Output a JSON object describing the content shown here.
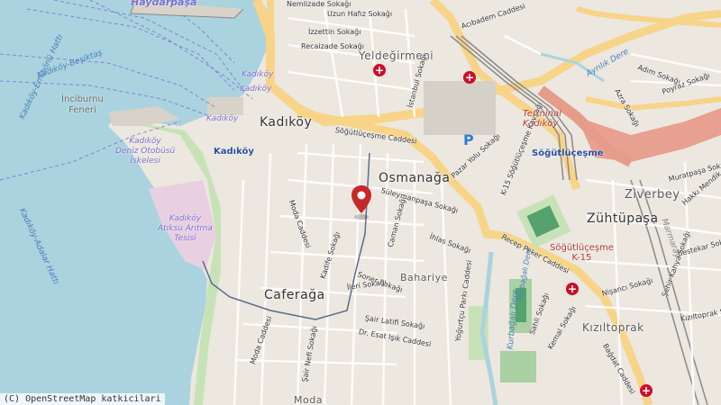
{
  "map": {
    "marker": "map-pin-icon",
    "attribution": "(C) OpenStreetMap katkicilari",
    "districts": {
      "kadikoy": "Kadıköy",
      "osmanaga": "Osmanağa",
      "caferaga": "Caferağa",
      "zuhtupasa": "Zühtüpaşa",
      "ziverbey": "Ziverbey",
      "yeldegirmeni": "Yeldeğirmeni",
      "kiziltoprak": "Kızıltoprak",
      "bahariye": "Bahariye",
      "haydarpasa": "Haydarpaşa",
      "moda": "Moda"
    },
    "pois": {
      "incirburnu": "İnciburnu\nFeneri",
      "otobus": "Kadıköy\nDeniz Otobüsü\nİskelesi",
      "aritma": "Kadıköy\nAtıksu Arıtma\nTesisi",
      "kadikoy_stop": "Kadıköy",
      "terminal": "Terminal\nKadıköy",
      "sogutlucesme_station": "Söğütlüçeşme",
      "k15a": "Söğütlüçeşme\nK-15",
      "kadikoy_ferry1": "Kadıköy",
      "kadikoy_ferry2": "Kadıköy",
      "kadikoy_ferry3": "Kadıköy"
    },
    "ferry_routes": {
      "r1": "Kadıköy-Eminönü Hattı",
      "r2": "Kadıköy-Adalar Hattı",
      "r3": "Kadıköy-Beşiktaş"
    },
    "streets": {
      "sogutlucesme": "Söğütlüçeşme Caddesi",
      "sogutlucesme_kavsagi": "K-15 Söğütlüçeşme Kavşağı",
      "recep": "Recep Peker Caddesi",
      "pazar": "Pazar Yolu Sokağı",
      "acibadem": "Acıbadem Caddesi",
      "dr_esat": "Dr. Esat Işık Caddesi",
      "sair_latifi": "Şair Latifi Sokağı",
      "soner": "Soner Sokağı",
      "ileri": "İleri Sokağı",
      "suleymanpasa": "Süleymanpaşa Sokağı",
      "ihlas": "İhlas Sokağı",
      "moda": "Moda Caddesi",
      "moda2": "Moda Caddesi",
      "yogurtcu": "Yoğurtçu Parkı Caddesi",
      "nisanci": "Nişancı Sokağı",
      "bagdat": "Bağdat Caddesi",
      "sair_nefi": "Şair Nefi Sokağı",
      "kadife": "Kadife Sokağı",
      "caman": "Caman Sokağı",
      "uzun_hafiz": "Uzun Hafız Sokağı",
      "izzettin": "İzzettin Sokağı",
      "recaizade": "Recaizade Sokağı",
      "nemlizade": "Nemlizade Sokağı",
      "istanbul": "İstanbul Sokağı",
      "adim": "Adım Sokağı",
      "poyraz": "Poyraz Sokağı",
      "azra": "Azra Sokağı",
      "murat": "Muratpaşa Sokağı",
      "kiziltoprak_st": "Kızıltoprak Sokağı",
      "sahli": "Sahli Sokağı",
      "kemal": "Kemal Sokağı",
      "bestekar": "Bestekar Sokağı",
      "hakki": "Hakkı Mendik Sokağı",
      "sehir": "Şehir Kahya Sokağı",
      "marmaray": "Marmaray",
      "ayrilik": "Ayrılık Dere",
      "kurbagali": "Kurbağalı Dere",
      "kurbagali2": "Kurbağalı Dere",
      "bahariye_st": "Bahariye",
      "moda_st": "Moda"
    }
  }
}
